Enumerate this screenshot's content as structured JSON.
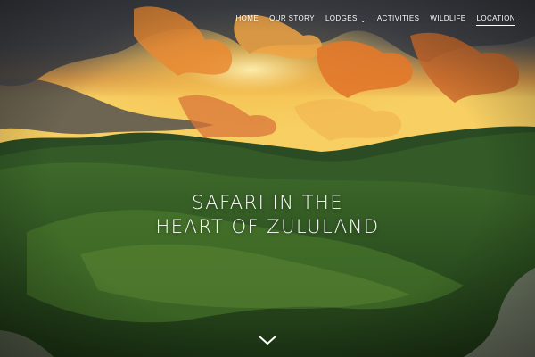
{
  "nav": {
    "items": [
      {
        "label": "HOME"
      },
      {
        "label": "OUR STORY"
      },
      {
        "label": "LODGES",
        "has_dropdown": true
      },
      {
        "label": "ACTIVITIES"
      },
      {
        "label": "WILDLIFE"
      },
      {
        "label": "LOCATION",
        "active": true
      }
    ],
    "dropdown_icon": "chevron-down-icon"
  },
  "hero": {
    "headline_line1": "SAFARI IN THE",
    "headline_line2": "HEART OF ZULULAND",
    "scroll_icon": "chevron-down-icon",
    "colors": {
      "sky_top": "#3c4450",
      "sunset_glow": "#f6c85a",
      "cloud_orange": "#e0792a",
      "hills_green": "#2f5a22",
      "text": "#ffffff"
    }
  }
}
